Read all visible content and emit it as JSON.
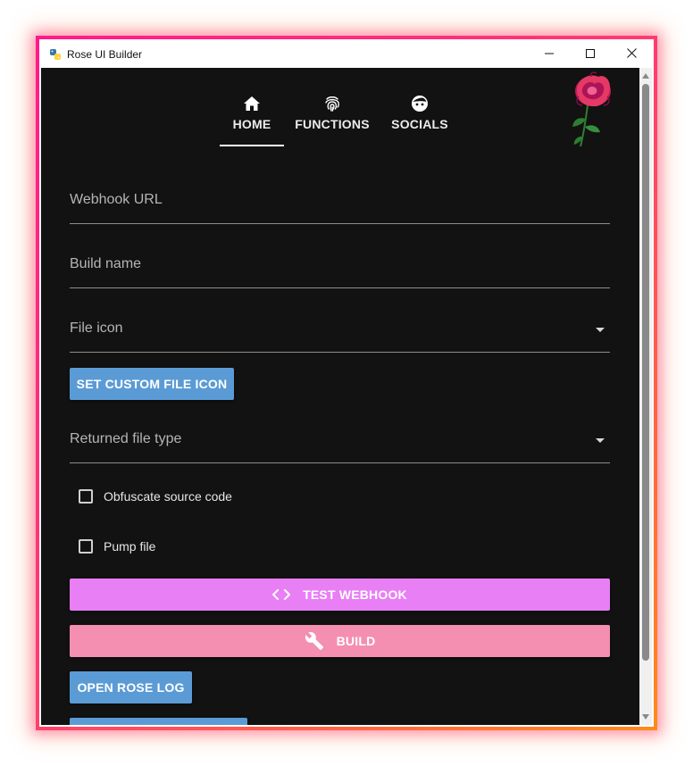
{
  "window": {
    "title": "Rose UI Builder",
    "app_icon": "python-icon",
    "controls": [
      "minimize-icon",
      "maximize-icon",
      "close-icon"
    ]
  },
  "tabs": [
    {
      "label": "HOME",
      "icon": "home-icon",
      "active": true
    },
    {
      "label": "FUNCTIONS",
      "icon": "fingerprint-icon",
      "active": false
    },
    {
      "label": "SOCIALS",
      "icon": "face-icon",
      "active": false
    }
  ],
  "logo": "rose-logo",
  "fields": {
    "webhook_url": {
      "label": "Webhook URL",
      "value": ""
    },
    "build_name": {
      "label": "Build name",
      "value": ""
    },
    "file_icon": {
      "label": "File icon",
      "value": ""
    },
    "returned_file_type": {
      "label": "Returned file type",
      "value": ""
    }
  },
  "buttons": {
    "set_custom_file_icon": "SET CUSTOM FILE ICON",
    "test_webhook": "TEST WEBHOOK",
    "build": "BUILD",
    "open_rose_log": "OPEN ROSE LOG"
  },
  "checkboxes": {
    "obfuscate": {
      "label": "Obfuscate source code",
      "checked": false
    },
    "pump": {
      "label": "Pump file",
      "checked": false
    }
  },
  "colors": {
    "background": "#121212",
    "blue_button": "#5b9bd5",
    "pink_button": "#e87ff5",
    "rose_button": "#f48fb1",
    "window_border": "#ff3d7f"
  }
}
